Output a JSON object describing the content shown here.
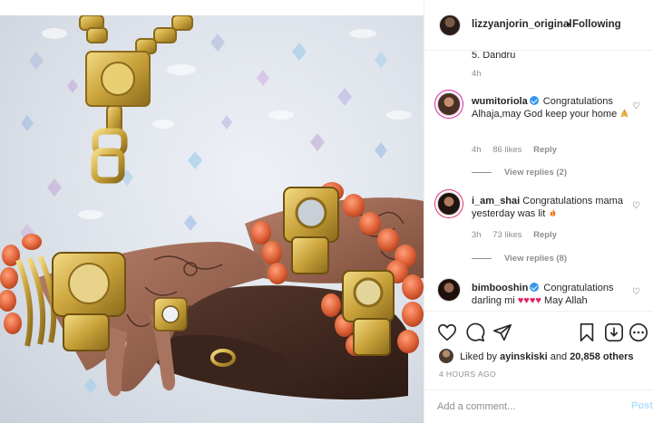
{
  "header": {
    "username": "lizzyanjorin_original",
    "separator": "•",
    "follow_label": "Following"
  },
  "comments": {
    "truncated_text": "5. Dandru",
    "truncated_time": "4h",
    "items": [
      {
        "username": "wumitoriola",
        "verified": true,
        "text": "Congratulations Alhaja,may God keep your home",
        "emoji": "praying-hands",
        "time": "4h",
        "likes": "86 likes",
        "reply": "Reply",
        "view_replies": "View replies (2)"
      },
      {
        "username": "i_am_shai",
        "verified": false,
        "text": "Congratulations mama yesterday was lit",
        "emoji": "fire",
        "time": "3h",
        "likes": "73 likes",
        "reply": "Reply",
        "view_replies": "View replies (8)"
      },
      {
        "username": "bimbooshin",
        "verified": true,
        "text": "Congratulations darling mi",
        "text_after": "May Allah",
        "emoji": "red-hearts"
      }
    ]
  },
  "actions": {
    "liked_by_prefix": "Liked by",
    "liked_by_user": "ayinskiski",
    "liked_by_and": "and",
    "liked_by_others": "20,858 others",
    "timestamp": "4 HOURS AGO"
  },
  "add_comment": {
    "placeholder": "Add a comment...",
    "post_label": "Post"
  },
  "icons": [
    "heart-icon",
    "comment-icon",
    "share-icon",
    "bookmark-icon",
    "download-icon",
    "more-icon",
    "verified-icon"
  ],
  "colors": {
    "accent": "#3897f0",
    "post_disabled": "#b2dffc",
    "muted": "#8e8e8e",
    "coral_beads": "#e0643a",
    "gold": "#c9a23a"
  }
}
